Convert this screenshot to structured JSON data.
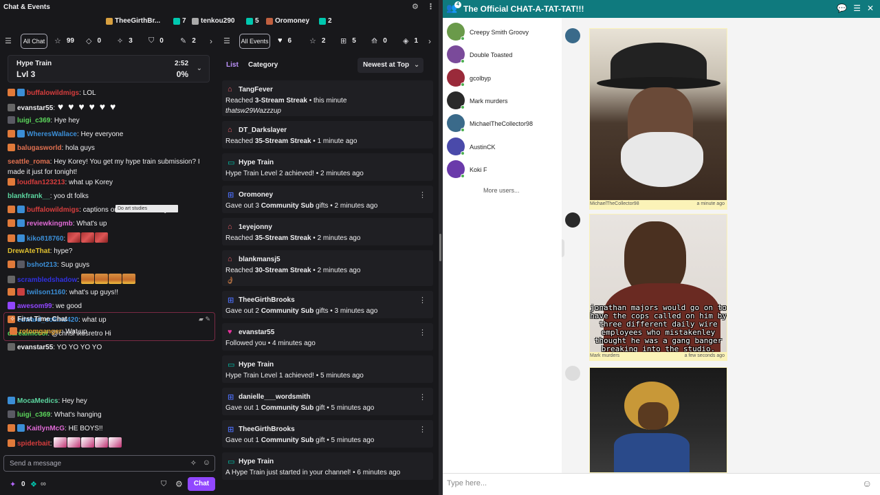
{
  "left": {
    "title": "Chat & Events",
    "gifts": [
      {
        "name": "TheeGirthBr...",
        "count": ""
      },
      {
        "name": "",
        "count": "7"
      },
      {
        "name": "tenkou290",
        "count": ""
      },
      {
        "name": "",
        "count": "5"
      },
      {
        "name": "Oromoney",
        "count": ""
      },
      {
        "name": "",
        "count": "2"
      }
    ],
    "chat_tab": "All Chat",
    "chat_stats": [
      "99",
      "0",
      "3",
      "0",
      "2"
    ],
    "events_tab": "All Events",
    "event_stats": [
      "6",
      "2",
      "5",
      "0",
      "1"
    ],
    "hype_train": {
      "title": "Hype Train",
      "level": "Lvl 3",
      "timer": "2:52",
      "percent": "0%"
    },
    "messages": [
      {
        "user": "buffalowildmigs",
        "color": "#d63d3d",
        "text": ": LOL",
        "badges": [
          "bits",
          "sub"
        ]
      },
      {
        "user": "evanstar55",
        "color": "#efeff1",
        "text": ":",
        "badges": [
          "vid"
        ],
        "hearts": 6
      },
      {
        "user": "luigi_c369",
        "color": "#5cd65c",
        "text": ": Hye hey",
        "badges": [
          "mod"
        ]
      },
      {
        "user": "WheresWallace",
        "color": "#3b8ed6",
        "text": ": Hey everyone",
        "badges": [
          "bits",
          "sub"
        ]
      },
      {
        "user": "balugasworld",
        "color": "#e07050",
        "text": ": hola guys",
        "badges": [
          "bits"
        ]
      },
      {
        "user": "seattle_roma",
        "color": "#e07050",
        "text": ": Hey Korey! You get my hype train submission? I made it just for tonight!",
        "badges": []
      },
      {
        "user": "loudfan123213",
        "color": "#d63d3d",
        "text": ": what up Korey",
        "badges": [
          "bits"
        ]
      },
      {
        "user": "blankfrank__",
        "color": "#5cd6a0",
        "text": ": yoo dt folks",
        "badges": []
      },
      {
        "user": "buffalowildmigs",
        "color": "#d63d3d",
        "text": ": captions on memes is crazy",
        "badges": [
          "bits",
          "sub"
        ]
      },
      {
        "user": "reviewkingmb",
        "color": "#e06ad6",
        "text": ": What's up",
        "badges": [
          "bits",
          "sub"
        ]
      },
      {
        "user": "kiko818760",
        "color": "#3b8ed6",
        "text": ":",
        "badges": [
          "bits",
          "sub"
        ],
        "emotes": "red3"
      },
      {
        "user": "DrewAteThat",
        "color": "#e0c030",
        "text": ": hype?",
        "badges": []
      },
      {
        "user": "bshot213",
        "color": "#3b8ed6",
        "text": ": Sup guys",
        "badges": [
          "bits",
          "speaker"
        ]
      },
      {
        "user": "scrambledshadow",
        "color": "#3030e0",
        "text": ":",
        "badges": [
          "vid"
        ],
        "emotes": "hype4"
      },
      {
        "user": "twilson1160",
        "color": "#3b8ed6",
        "text": ": what's up guys!!",
        "badges": [
          "bits",
          "red"
        ]
      },
      {
        "user": "awesom99",
        "color": "#9146ff",
        "text": ": we good",
        "badges": [
          "prime"
        ]
      },
      {
        "user": "edward_collins420",
        "color": "#3b8ed6",
        "text": ": what up",
        "badges": [
          "bits"
        ]
      },
      {
        "user": "darealmccoi",
        "color": "#5cd65c",
        "text": ": @chrisl ikesretro Hi",
        "badges": []
      },
      {
        "user": "evanstar55",
        "color": "#efeff1",
        "text": ": YO YO YO YO",
        "badges": [
          "vid"
        ]
      }
    ],
    "tooltip": "Do art studies",
    "first_time_chat": {
      "title": "First Time Chat",
      "user": "rotomganger",
      "text": ": Wat up"
    },
    "messages2": [
      {
        "user": "MocaMedics",
        "color": "#5cd6a0",
        "text": ": Hey hey",
        "badges": [
          "sub"
        ]
      },
      {
        "user": "luigi_c369",
        "color": "#5cd65c",
        "text": ": What's hanging",
        "badges": [
          "mod"
        ]
      },
      {
        "user": "KaitlynMcG",
        "color": "#e06ad6",
        "text": ": HE BOYS!!",
        "badges": [
          "bits",
          "sub"
        ]
      },
      {
        "user": "spiderbait",
        "color": "#d63d3d",
        "text": ":",
        "badges": [
          "bits"
        ],
        "emotes": "x5"
      }
    ],
    "send_placeholder": "Send a message",
    "points": "0",
    "infinity": "∞",
    "chat_button": "Chat",
    "events": {
      "tab_list": "List",
      "tab_category": "Category",
      "sort": "Newest at Top",
      "items": [
        {
          "icon": "streak",
          "user": "TangFever",
          "desc_pre": "Reached ",
          "desc_bold": "3-Stream Streak",
          "desc_post": " • this minute",
          "extra": "thatsw29Wazzzup"
        },
        {
          "icon": "streak",
          "user": "DT_Darkslayer",
          "desc_pre": "Reached ",
          "desc_bold": "35-Stream Streak",
          "desc_post": " • 1 minute ago",
          "extra": ""
        },
        {
          "icon": "hype",
          "user": "Hype Train",
          "desc_pre": "Hype Train Level 2 achieved! • 2 minutes ago",
          "desc_bold": "",
          "desc_post": "",
          "extra": ""
        },
        {
          "icon": "gift",
          "user": "Oromoney",
          "desc_pre": "Gave out 3 ",
          "desc_bold": "Community Sub",
          "desc_post": " gifts • 2 minutes ago",
          "extra": ""
        },
        {
          "icon": "streak",
          "user": "1eyejonny",
          "desc_pre": "Reached ",
          "desc_bold": "35-Stream Streak",
          "desc_post": " • 2 minutes ago",
          "extra": ""
        },
        {
          "icon": "streak",
          "user": "blankmansj5",
          "desc_pre": "Reached ",
          "desc_bold": "30-Stream Streak",
          "desc_post": " • 2 minutes ago",
          "extra": "👌🏾"
        },
        {
          "icon": "gift",
          "user": "TheeGirthBrooks",
          "desc_pre": "Gave out 2 ",
          "desc_bold": "Community Sub",
          "desc_post": " gifts • 3 minutes ago",
          "extra": ""
        },
        {
          "icon": "follow",
          "user": "evanstar55",
          "desc_pre": "Followed you • 4 minutes ago",
          "desc_bold": "",
          "desc_post": "",
          "extra": ""
        },
        {
          "icon": "hype",
          "user": "Hype Train",
          "desc_pre": "Hype Train Level 1 achieved! • 5 minutes ago",
          "desc_bold": "",
          "desc_post": "",
          "extra": ""
        },
        {
          "icon": "gift",
          "user": "danielle___wordsmith",
          "desc_pre": "Gave out 1 ",
          "desc_bold": "Community Sub",
          "desc_post": " gift • 5 minutes ago",
          "extra": ""
        },
        {
          "icon": "gift",
          "user": "TheeGirthBrooks",
          "desc_pre": "Gave out 1 ",
          "desc_bold": "Community Sub",
          "desc_post": " gift • 5 minutes ago",
          "extra": ""
        },
        {
          "icon": "hype",
          "user": "Hype Train",
          "desc_pre": "A Hype Train just started in your channel! • 6 minutes ago",
          "desc_bold": "",
          "desc_post": "",
          "extra": ""
        }
      ]
    }
  },
  "right": {
    "title": "The Official CHAT-A-TAT-TAT!!!",
    "badge_count": "4",
    "users": [
      {
        "name": "Creepy Smith Groovy",
        "color": "#6a9a4a"
      },
      {
        "name": "Double Toasted",
        "color": "#7a4a9a"
      },
      {
        "name": "gcolbyp",
        "color": "#9a2a3a"
      },
      {
        "name": "Mark murders",
        "color": "#2a2a2a"
      },
      {
        "name": "MichaelTheCollector98",
        "color": "#3a6a8a"
      },
      {
        "name": "AustinCK",
        "color": "#4a4aaa"
      },
      {
        "name": "Koki F",
        "color": "#6a3aaa"
      }
    ],
    "more_users": "More users...",
    "messages": [
      {
        "name": "MichaelTheCollector98",
        "time": "a minute ago"
      },
      {
        "name": "Mark murders",
        "time": "a few seconds ago",
        "caption": "jonathan majors would go on to have the cops called on him by three different daily wire employees who mistakenley thought he was a gang banger breaking into the studio."
      },
      {
        "name": "",
        "time": ""
      }
    ],
    "placeholder": "Type here..."
  }
}
